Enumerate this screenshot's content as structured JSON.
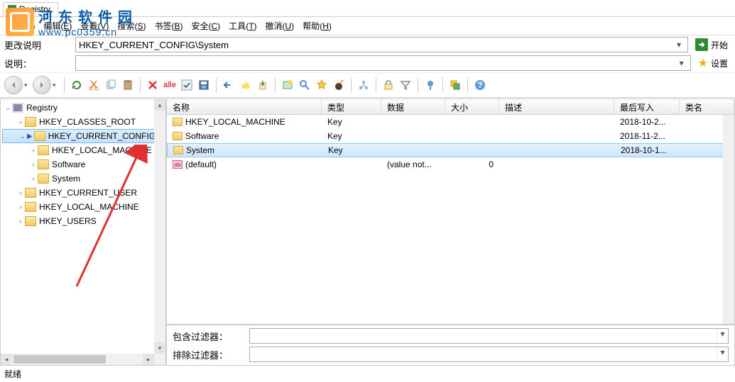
{
  "watermark": {
    "title": "河东软件园",
    "url": "www.pc0359.cn"
  },
  "tab": {
    "label": "Registry"
  },
  "menu": {
    "file": "文件",
    "file_k": "F",
    "edit": "编辑",
    "edit_k": "E",
    "view": "查看",
    "view_k": "V",
    "search": "搜索",
    "search_k": "S",
    "bookmark": "书签",
    "bookmark_k": "B",
    "security": "安全",
    "security_k": "C",
    "tools": "工具",
    "tools_k": "T",
    "undo": "撤消",
    "undo_k": "U",
    "help": "帮助",
    "help_k": "H"
  },
  "path": {
    "label": "更改说明",
    "value": "HKEY_CURRENT_CONFIG\\System",
    "go": "开始"
  },
  "desc": {
    "label": "说明：",
    "value": "",
    "settings": "设置"
  },
  "tree": {
    "root": "Registry",
    "items": [
      {
        "label": "HKEY_CLASSES_ROOT",
        "expanded": false,
        "depth": 1
      },
      {
        "label": "HKEY_CURRENT_CONFIG",
        "expanded": true,
        "selected": true,
        "depth": 1
      },
      {
        "label": "HKEY_LOCAL_MACHINE",
        "expanded": false,
        "depth": 2
      },
      {
        "label": "Software",
        "expanded": false,
        "depth": 2
      },
      {
        "label": "System",
        "expanded": false,
        "depth": 2
      },
      {
        "label": "HKEY_CURRENT_USER",
        "expanded": false,
        "depth": 1
      },
      {
        "label": "HKEY_LOCAL_MACHINE",
        "expanded": false,
        "depth": 1
      },
      {
        "label": "HKEY_USERS",
        "expanded": false,
        "depth": 1
      }
    ]
  },
  "list": {
    "headers": {
      "name": "名称",
      "type": "类型",
      "data": "数据",
      "size": "大小",
      "desc": "描述",
      "lastwrite": "最后写入",
      "classname": "类名"
    },
    "rows": [
      {
        "icon": "folder",
        "name": "HKEY_LOCAL_MACHINE",
        "type": "Key",
        "data": "",
        "size": "",
        "desc": "",
        "lw": "2018-10-2...",
        "cls": ""
      },
      {
        "icon": "folder",
        "name": "Software",
        "type": "Key",
        "data": "",
        "size": "",
        "desc": "",
        "lw": "2018-11-2...",
        "cls": ""
      },
      {
        "icon": "folder",
        "name": "System",
        "type": "Key",
        "data": "",
        "size": "",
        "desc": "",
        "lw": "2018-10-1...",
        "cls": "",
        "highlight": true
      },
      {
        "icon": "ab",
        "name": "(default)",
        "type": "",
        "data": "(value not...",
        "size": "0",
        "desc": "",
        "lw": "",
        "cls": ""
      }
    ]
  },
  "filters": {
    "include": "包含过滤器：",
    "exclude": "排除过滤器："
  },
  "status": "就绪"
}
